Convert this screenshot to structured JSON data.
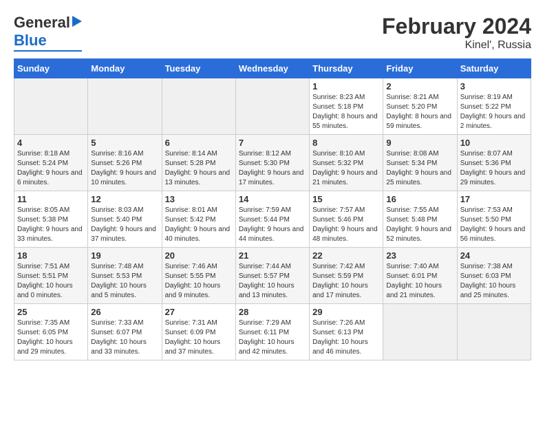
{
  "header": {
    "logo_line1": "General",
    "logo_line2": "Blue",
    "title": "February 2024",
    "subtitle": "Kinel', Russia"
  },
  "weekdays": [
    "Sunday",
    "Monday",
    "Tuesday",
    "Wednesday",
    "Thursday",
    "Friday",
    "Saturday"
  ],
  "weeks": [
    [
      {
        "num": "",
        "info": ""
      },
      {
        "num": "",
        "info": ""
      },
      {
        "num": "",
        "info": ""
      },
      {
        "num": "",
        "info": ""
      },
      {
        "num": "1",
        "info": "Sunrise: 8:23 AM\nSunset: 5:18 PM\nDaylight: 8 hours and 55 minutes."
      },
      {
        "num": "2",
        "info": "Sunrise: 8:21 AM\nSunset: 5:20 PM\nDaylight: 8 hours and 59 minutes."
      },
      {
        "num": "3",
        "info": "Sunrise: 8:19 AM\nSunset: 5:22 PM\nDaylight: 9 hours and 2 minutes."
      }
    ],
    [
      {
        "num": "4",
        "info": "Sunrise: 8:18 AM\nSunset: 5:24 PM\nDaylight: 9 hours and 6 minutes."
      },
      {
        "num": "5",
        "info": "Sunrise: 8:16 AM\nSunset: 5:26 PM\nDaylight: 9 hours and 10 minutes."
      },
      {
        "num": "6",
        "info": "Sunrise: 8:14 AM\nSunset: 5:28 PM\nDaylight: 9 hours and 13 minutes."
      },
      {
        "num": "7",
        "info": "Sunrise: 8:12 AM\nSunset: 5:30 PM\nDaylight: 9 hours and 17 minutes."
      },
      {
        "num": "8",
        "info": "Sunrise: 8:10 AM\nSunset: 5:32 PM\nDaylight: 9 hours and 21 minutes."
      },
      {
        "num": "9",
        "info": "Sunrise: 8:08 AM\nSunset: 5:34 PM\nDaylight: 9 hours and 25 minutes."
      },
      {
        "num": "10",
        "info": "Sunrise: 8:07 AM\nSunset: 5:36 PM\nDaylight: 9 hours and 29 minutes."
      }
    ],
    [
      {
        "num": "11",
        "info": "Sunrise: 8:05 AM\nSunset: 5:38 PM\nDaylight: 9 hours and 33 minutes."
      },
      {
        "num": "12",
        "info": "Sunrise: 8:03 AM\nSunset: 5:40 PM\nDaylight: 9 hours and 37 minutes."
      },
      {
        "num": "13",
        "info": "Sunrise: 8:01 AM\nSunset: 5:42 PM\nDaylight: 9 hours and 40 minutes."
      },
      {
        "num": "14",
        "info": "Sunrise: 7:59 AM\nSunset: 5:44 PM\nDaylight: 9 hours and 44 minutes."
      },
      {
        "num": "15",
        "info": "Sunrise: 7:57 AM\nSunset: 5:46 PM\nDaylight: 9 hours and 48 minutes."
      },
      {
        "num": "16",
        "info": "Sunrise: 7:55 AM\nSunset: 5:48 PM\nDaylight: 9 hours and 52 minutes."
      },
      {
        "num": "17",
        "info": "Sunrise: 7:53 AM\nSunset: 5:50 PM\nDaylight: 9 hours and 56 minutes."
      }
    ],
    [
      {
        "num": "18",
        "info": "Sunrise: 7:51 AM\nSunset: 5:51 PM\nDaylight: 10 hours and 0 minutes."
      },
      {
        "num": "19",
        "info": "Sunrise: 7:48 AM\nSunset: 5:53 PM\nDaylight: 10 hours and 5 minutes."
      },
      {
        "num": "20",
        "info": "Sunrise: 7:46 AM\nSunset: 5:55 PM\nDaylight: 10 hours and 9 minutes."
      },
      {
        "num": "21",
        "info": "Sunrise: 7:44 AM\nSunset: 5:57 PM\nDaylight: 10 hours and 13 minutes."
      },
      {
        "num": "22",
        "info": "Sunrise: 7:42 AM\nSunset: 5:59 PM\nDaylight: 10 hours and 17 minutes."
      },
      {
        "num": "23",
        "info": "Sunrise: 7:40 AM\nSunset: 6:01 PM\nDaylight: 10 hours and 21 minutes."
      },
      {
        "num": "24",
        "info": "Sunrise: 7:38 AM\nSunset: 6:03 PM\nDaylight: 10 hours and 25 minutes."
      }
    ],
    [
      {
        "num": "25",
        "info": "Sunrise: 7:35 AM\nSunset: 6:05 PM\nDaylight: 10 hours and 29 minutes."
      },
      {
        "num": "26",
        "info": "Sunrise: 7:33 AM\nSunset: 6:07 PM\nDaylight: 10 hours and 33 minutes."
      },
      {
        "num": "27",
        "info": "Sunrise: 7:31 AM\nSunset: 6:09 PM\nDaylight: 10 hours and 37 minutes."
      },
      {
        "num": "28",
        "info": "Sunrise: 7:29 AM\nSunset: 6:11 PM\nDaylight: 10 hours and 42 minutes."
      },
      {
        "num": "29",
        "info": "Sunrise: 7:26 AM\nSunset: 6:13 PM\nDaylight: 10 hours and 46 minutes."
      },
      {
        "num": "",
        "info": ""
      },
      {
        "num": "",
        "info": ""
      }
    ]
  ]
}
